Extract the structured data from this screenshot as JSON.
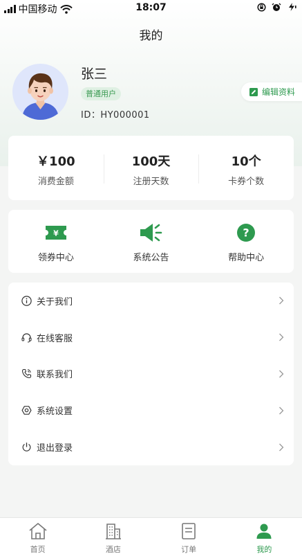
{
  "status_bar": {
    "carrier": "中国移动",
    "time": "18:07"
  },
  "header": {
    "title": "我的"
  },
  "profile": {
    "name": "张三",
    "badge": "普通用户",
    "id_text": "ID：HY000001",
    "edit_label": "编辑资料"
  },
  "stats": [
    {
      "value": "￥100",
      "label": "消费金额"
    },
    {
      "value": "100天",
      "label": "注册天数"
    },
    {
      "value": "10个",
      "label": "卡券个数"
    }
  ],
  "features": [
    {
      "icon": "coupon-icon",
      "label": "领券中心"
    },
    {
      "icon": "announcement-icon",
      "label": "系统公告"
    },
    {
      "icon": "help-icon",
      "label": "帮助中心"
    }
  ],
  "menu": [
    {
      "icon": "info-icon",
      "label": "关于我们"
    },
    {
      "icon": "headset-icon",
      "label": "在线客服"
    },
    {
      "icon": "phone-icon",
      "label": "联系我们"
    },
    {
      "icon": "settings-icon",
      "label": "系统设置"
    },
    {
      "icon": "power-icon",
      "label": "退出登录"
    }
  ],
  "tabbar": [
    {
      "icon": "home-icon",
      "label": "首页",
      "active": false
    },
    {
      "icon": "hotel-icon",
      "label": "酒店",
      "active": false
    },
    {
      "icon": "order-icon",
      "label": "订单",
      "active": false
    },
    {
      "icon": "user-icon",
      "label": "我的",
      "active": true
    }
  ],
  "colors": {
    "accent": "#2e9a4f",
    "badge_bg": "#dff0e3",
    "page_bg": "#f4f5f4",
    "inactive": "#777777"
  }
}
